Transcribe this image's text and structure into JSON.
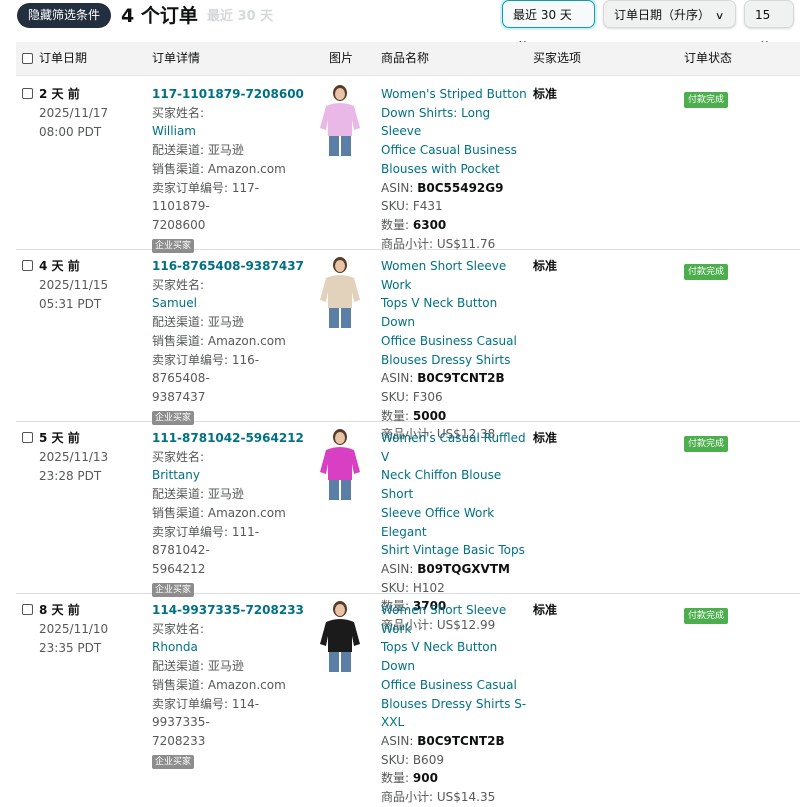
{
  "toolbar": {
    "hide_filters_label": "隐藏筛选条件",
    "orders_count_label": "4 个订单",
    "range_hint": "最近 30 天",
    "range_select": "最近 30 天",
    "sort_select": "订单日期（升序）",
    "per_page_select": "15"
  },
  "table": {
    "headers": {
      "order_date": "订单日期",
      "order_details": "订单详情",
      "image": "图片",
      "product_name": "商品名称",
      "buyer_option": "买家选项",
      "order_status": "订单状态"
    }
  },
  "labels": {
    "buyer_name": "买家姓名:",
    "quantity": "数量:",
    "subtotal": "商品小计:",
    "business_buyer": "企业买家",
    "asin": "ASIN:",
    "sku": "SKU:"
  },
  "orders": [
    {
      "ago": "2 天 前",
      "date": "2025/11/17",
      "time": "08:00 PDT",
      "order_id": "117-1101879-7208600",
      "buyer": "William",
      "fulfillment": "配送渠道: 亚马逊",
      "channel": "销售渠道: Amazon.com",
      "seller_order_id_line1": "卖家订单编号: 117-1101879-",
      "seller_order_id_line2": "7208600",
      "title_lines": [
        "Women's Striped Button",
        "Down Shirts: Long Sleeve",
        "Office Casual Business",
        "Blouses with Pocket"
      ],
      "asin": "B0C55492G9",
      "sku": "F431",
      "quantity": "6300",
      "subtotal": "US$11.76",
      "buyer_option": "标准",
      "status": "付款完成",
      "image_color": "#e9b8e6"
    },
    {
      "ago": "4 天 前",
      "date": "2025/11/15",
      "time": "05:31 PDT",
      "order_id": "116-8765408-9387437",
      "buyer": "Samuel",
      "fulfillment": "配送渠道: 亚马逊",
      "channel": "销售渠道: Amazon.com",
      "seller_order_id_line1": "卖家订单编号: 116-8765408-",
      "seller_order_id_line2": "9387437",
      "title_lines": [
        "Women Short Sleeve Work",
        "Tops V Neck Button Down",
        "Office Business Casual",
        "Blouses Dressy Shirts"
      ],
      "asin": "B0C9TCNT2B",
      "sku": "F306",
      "quantity": "5000",
      "subtotal": "US$12.38",
      "buyer_option": "标准",
      "status": "付款完成",
      "image_color": "#e3d2bb"
    },
    {
      "ago": "5 天 前",
      "date": "2025/11/13",
      "time": "23:28 PDT",
      "order_id": "111-8781042-5964212",
      "buyer": "Brittany",
      "fulfillment": "配送渠道: 亚马逊",
      "channel": "销售渠道: Amazon.com",
      "seller_order_id_line1": "卖家订单编号: 111-8781042-",
      "seller_order_id_line2": "5964212",
      "title_lines": [
        "Women's Casual Ruffled V",
        "Neck Chiffon Blouse Short",
        "Sleeve Office Work Elegant",
        "Shirt Vintage Basic Tops"
      ],
      "asin": "B09TQGXVTM",
      "sku": "H102",
      "quantity": "3700",
      "subtotal": "US$12.99",
      "buyer_option": "标准",
      "status": "付款完成",
      "image_color": "#d93fc2"
    },
    {
      "ago": "8 天 前",
      "date": "2025/11/10",
      "time": "23:35 PDT",
      "order_id": "114-9937335-7208233",
      "buyer": "Rhonda",
      "fulfillment": "配送渠道: 亚马逊",
      "channel": "销售渠道: Amazon.com",
      "seller_order_id_line1": "卖家订单编号: 114-9937335-",
      "seller_order_id_line2": "7208233",
      "title_lines": [
        "Women Short Sleeve Work",
        "Tops V Neck Button Down",
        "Office Business Casual",
        "Blouses Dressy Shirts S-XXL"
      ],
      "asin": "B0C9TCNT2B",
      "sku": "B609",
      "quantity": "900",
      "subtotal": "US$14.35",
      "buyer_option": "标准",
      "status": "付款完成",
      "image_color": "#1b1b1b"
    }
  ]
}
